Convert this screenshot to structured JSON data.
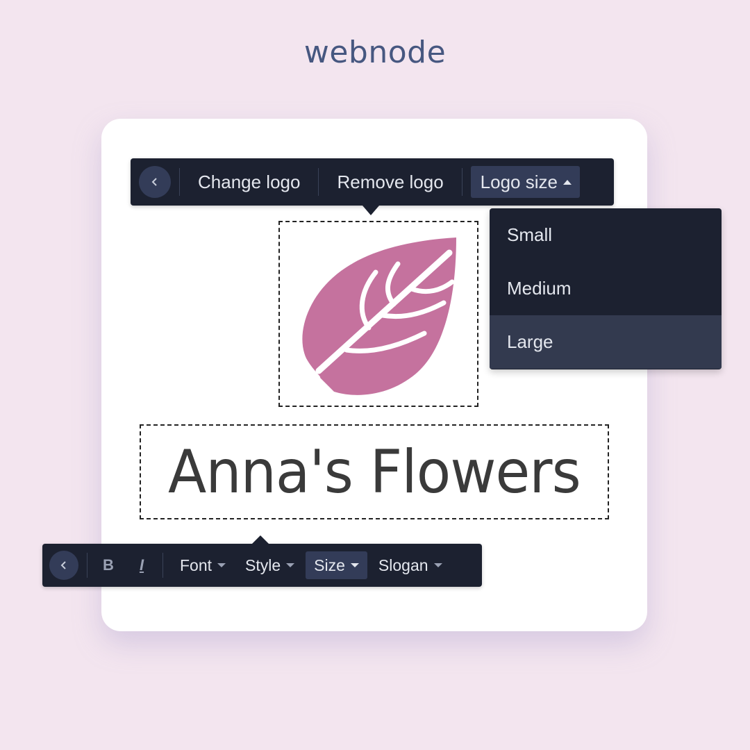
{
  "brand": {
    "name": "webnode"
  },
  "colors": {
    "background": "#f3e5ef",
    "toolbar": "#1c2130",
    "toolbar_active": "#333c58",
    "brand": "#465780",
    "logo_leaf": "#c5729e",
    "title_text": "#3a3a3a"
  },
  "logo_toolbar": {
    "back_icon": "chevron-left-icon",
    "items": [
      {
        "label": "Change logo"
      },
      {
        "label": "Remove logo"
      },
      {
        "label": "Logo size",
        "active": true,
        "icon": "caret-up-icon"
      }
    ]
  },
  "logo_size_dropdown": {
    "options": [
      {
        "label": "Small",
        "selected": false
      },
      {
        "label": "Medium",
        "selected": false
      },
      {
        "label": "Large",
        "selected": true
      }
    ]
  },
  "logo": {
    "icon": "leaf-icon"
  },
  "site_title": {
    "text": "Anna's Flowers"
  },
  "text_toolbar": {
    "back_icon": "chevron-left-icon",
    "bold_label": "B",
    "italic_label": "I",
    "items": [
      {
        "label": "Font",
        "active": false
      },
      {
        "label": "Style",
        "active": false
      },
      {
        "label": "Size",
        "active": true
      },
      {
        "label": "Slogan",
        "active": false
      }
    ]
  }
}
